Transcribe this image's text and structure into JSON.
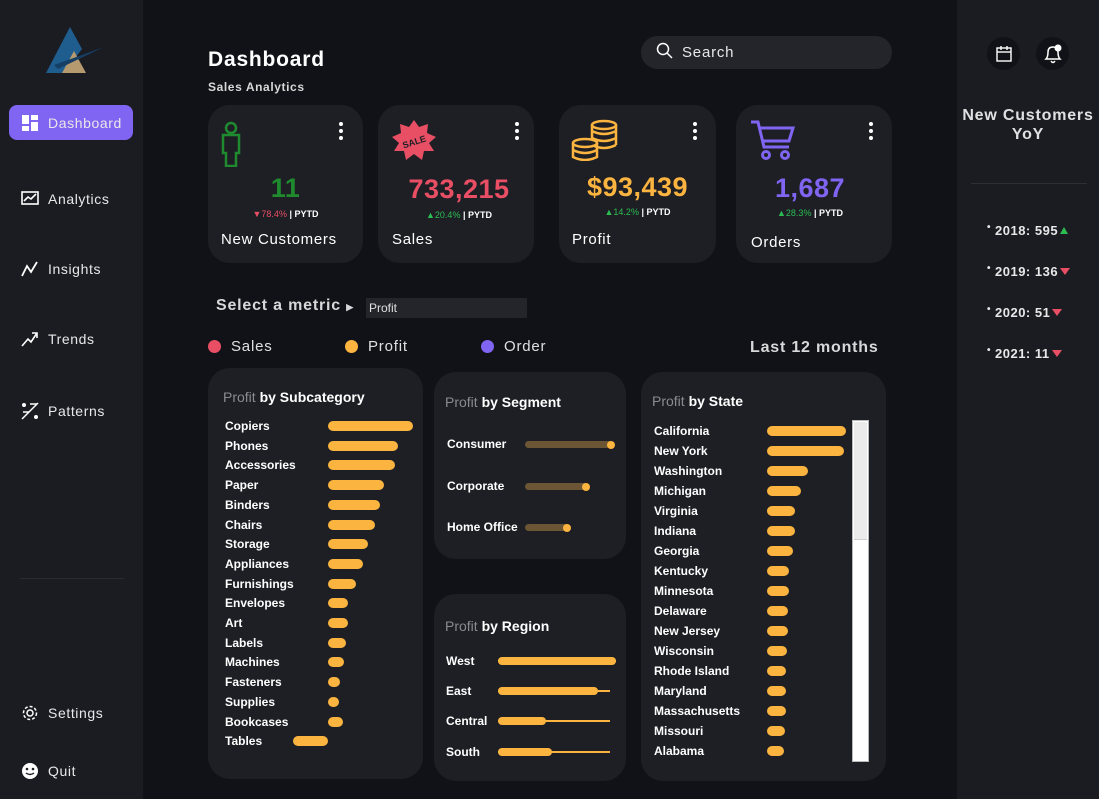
{
  "header": {
    "title": "Dashboard",
    "subtitle": "Sales Analytics",
    "search_placeholder": "Search"
  },
  "sidebar": {
    "items": [
      {
        "label": "Dashboard",
        "icon": "dashboard-icon",
        "active": true
      },
      {
        "label": "Analytics",
        "icon": "analytics-icon"
      },
      {
        "label": "Insights",
        "icon": "insights-icon"
      },
      {
        "label": "Trends",
        "icon": "trends-icon"
      },
      {
        "label": "Patterns",
        "icon": "patterns-icon"
      }
    ],
    "bottom": [
      {
        "label": "Settings",
        "icon": "gear-icon"
      },
      {
        "label": "Quit",
        "icon": "smiley-icon"
      }
    ]
  },
  "kpis": [
    {
      "label": "New Customers",
      "value": "11",
      "change": "78.4%",
      "direction": "down",
      "pytd": "| PYTD",
      "color": "#1f8a2e",
      "icon": "person-icon"
    },
    {
      "label": "Sales",
      "value": "733,215",
      "change": "20.4%",
      "direction": "up",
      "pytd": "| PYTD",
      "color": "#e84e64",
      "icon": "sale-badge-icon",
      "badge_text": "SALE"
    },
    {
      "label": "Profit",
      "value": "$93,439",
      "change": "14.2%",
      "direction": "up",
      "pytd": "| PYTD",
      "color": "#fbb43f",
      "icon": "coins-icon"
    },
    {
      "label": "Orders",
      "value": "1,687",
      "change": "28.3%",
      "direction": "up",
      "pytd": "| PYTD",
      "color": "#8064f2",
      "icon": "cart-icon"
    }
  ],
  "metric_selector": {
    "label": "Select a metric",
    "value": "Profit"
  },
  "legend": [
    {
      "label": "Sales",
      "color": "#e84e64"
    },
    {
      "label": "Profit",
      "color": "#fbb43f"
    },
    {
      "label": "Order",
      "color": "#8064f2"
    }
  ],
  "period_label": "Last 12 months",
  "panels": {
    "subcategory": {
      "metric": "Profit",
      "title": " by Subcategory"
    },
    "segment": {
      "metric": "Profit",
      "title": " by Segment"
    },
    "region": {
      "metric": "Profit",
      "title": " by Region"
    },
    "state": {
      "metric": "Profit",
      "title": " by State"
    }
  },
  "chart_data": [
    {
      "type": "bar",
      "title": "Profit by Subcategory",
      "categories": [
        "Copiers",
        "Phones",
        "Accessories",
        "Paper",
        "Binders",
        "Chairs",
        "Storage",
        "Appliances",
        "Furnishings",
        "Envelopes",
        "Art",
        "Labels",
        "Machines",
        "Fasteners",
        "Supplies",
        "Bookcases",
        "Tables"
      ],
      "values": [
        85,
        70,
        67,
        56,
        52,
        47,
        40,
        35,
        28,
        20,
        20,
        18,
        16,
        12,
        11,
        15,
        -35
      ]
    },
    {
      "type": "bar",
      "title": "Profit by Segment",
      "categories": [
        "Consumer",
        "Corporate",
        "Home Office"
      ],
      "values": [
        88,
        63,
        44
      ]
    },
    {
      "type": "bar",
      "title": "Profit by Region",
      "categories": [
        "West",
        "East",
        "Central",
        "South"
      ],
      "values": [
        118,
        100,
        48,
        54
      ],
      "totals": [
        118,
        112,
        112,
        112
      ]
    },
    {
      "type": "bar",
      "title": "Profit by State",
      "categories": [
        "California",
        "New York",
        "Washington",
        "Michigan",
        "Virginia",
        "Indiana",
        "Georgia",
        "Kentucky",
        "Minnesota",
        "Delaware",
        "New Jersey",
        "Wisconsin",
        "Rhode Island",
        "Maryland",
        "Massachusetts",
        "Missouri",
        "Alabama"
      ],
      "values": [
        79,
        77,
        41,
        34,
        28,
        28,
        26,
        22,
        22,
        21,
        21,
        20,
        19,
        19,
        19,
        18,
        17
      ]
    }
  ],
  "yoy": {
    "title": "New Customers YoY",
    "items": [
      {
        "label": "2018: 595",
        "direction": "up"
      },
      {
        "label": "2019: 136",
        "direction": "down"
      },
      {
        "label": "2020: 51",
        "direction": "down"
      },
      {
        "label": "2021: 11",
        "direction": "down"
      }
    ]
  },
  "right_icons": [
    "calendar-icon",
    "bell-icon"
  ],
  "colors": {
    "accent": "#8064f2",
    "profit": "#fbb43f",
    "sales": "#e84e64",
    "positive": "#2bbd52"
  }
}
